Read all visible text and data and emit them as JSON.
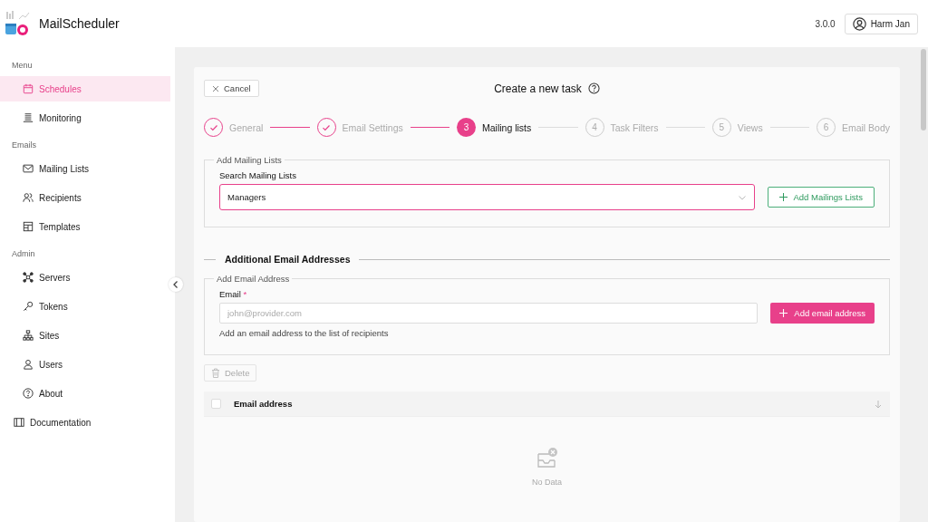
{
  "app": {
    "title": "MailScheduler",
    "version": "3.0.0",
    "user": "Harm Jan"
  },
  "sidebar": {
    "sections": [
      {
        "label": "Menu",
        "items": [
          {
            "label": "Schedules",
            "selected": true
          },
          {
            "label": "Monitoring",
            "selected": false
          }
        ]
      },
      {
        "label": "Emails",
        "items": [
          {
            "label": "Mailing Lists",
            "selected": false
          },
          {
            "label": "Recipients",
            "selected": false
          },
          {
            "label": "Templates",
            "selected": false
          }
        ]
      },
      {
        "label": "Admin",
        "items": [
          {
            "label": "Servers",
            "selected": false
          },
          {
            "label": "Tokens",
            "selected": false
          },
          {
            "label": "Sites",
            "selected": false
          },
          {
            "label": "Users",
            "selected": false
          },
          {
            "label": "About",
            "selected": false
          }
        ]
      }
    ],
    "footer_item": {
      "label": "Documentation",
      "selected": false
    }
  },
  "page": {
    "cancel": "Cancel",
    "title": "Create a new task"
  },
  "steps": [
    {
      "label": "General",
      "completed": true,
      "selected": false
    },
    {
      "label": "Email Settings",
      "completed": true,
      "selected": false
    },
    {
      "number": "3",
      "label": "Mailing lists",
      "completed": false,
      "selected": true
    },
    {
      "number": "4",
      "label": "Task Filters",
      "completed": false,
      "selected": false
    },
    {
      "number": "5",
      "label": "Views",
      "completed": false,
      "selected": false
    },
    {
      "number": "6",
      "label": "Email Body",
      "completed": false,
      "selected": false
    }
  ],
  "mailing_lists": {
    "legend": "Add Mailing Lists",
    "label": "Search Mailing Lists",
    "value": "Managers",
    "focused": true,
    "button": "Add Mailings Lists"
  },
  "additional": {
    "heading": "Additional Email Addresses",
    "legend": "Add Email Address",
    "label": "Email",
    "required": "*",
    "placeholder": "john@provider.com",
    "help": "Add an email address to the list of recipients",
    "button": "Add email address"
  },
  "table": {
    "delete": "Delete",
    "header_checked": false,
    "columns": [
      "Email address"
    ],
    "empty": "No Data"
  }
}
